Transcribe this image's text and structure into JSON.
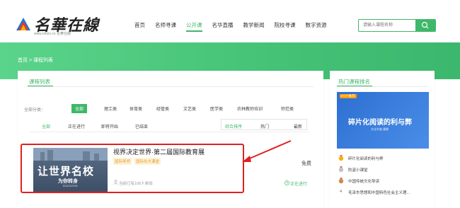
{
  "header": {
    "logo_text": "名華在線",
    "logo_sub": "www.mhzx.cn  名華在線"
  },
  "nav": [
    "首页",
    "名师寻课",
    "公开课",
    "名华直播",
    "教学新闻",
    "院校寻课",
    "数字资源"
  ],
  "search": {
    "placeholder": "请输入课程名称"
  },
  "breadcrumb": "首页 > 课程列表",
  "course_list": {
    "title": "课程列表",
    "category_label": "全部分类：",
    "categories": [
      "全部",
      "理工类",
      "体育类",
      "经管类",
      "文艺类",
      "医学类",
      "农林教师培训",
      "师范类"
    ],
    "tabs": [
      "全部",
      "正在进行",
      "即将开始",
      "已结束"
    ],
    "sorts": [
      "综合排序",
      "热门",
      "最新"
    ]
  },
  "course": {
    "thumb_text": "让世界名校",
    "thumb_sub": "为你转身",
    "thumb_tiny": "EDUCATION",
    "title": "视界决定世界·第二届国际教育展",
    "tags": [
      "国际导师",
      "国际化大课堂"
    ],
    "learners": "当前已有106人参加",
    "price": "免费",
    "status": "正在进行"
  },
  "hot": {
    "title": "热门课程排名",
    "badge": "HOT 推荐",
    "thumb_title": "碎片化阅读的利与弊",
    "thumb_sub": "文化学者  楊卿",
    "items": [
      {
        "rank": "1",
        "text": "碎片化阅读的利与弊"
      },
      {
        "rank": "2",
        "text": "防盗小课堂"
      },
      {
        "rank": "3",
        "text": "中国传统文化导读"
      },
      {
        "rank": "4",
        "text": "毛泽东思想和中国特色社会主义理..."
      }
    ]
  },
  "colors": {
    "accent": "#3fb76a",
    "highlight_border": "#e02020",
    "arrow": "#e02020"
  }
}
